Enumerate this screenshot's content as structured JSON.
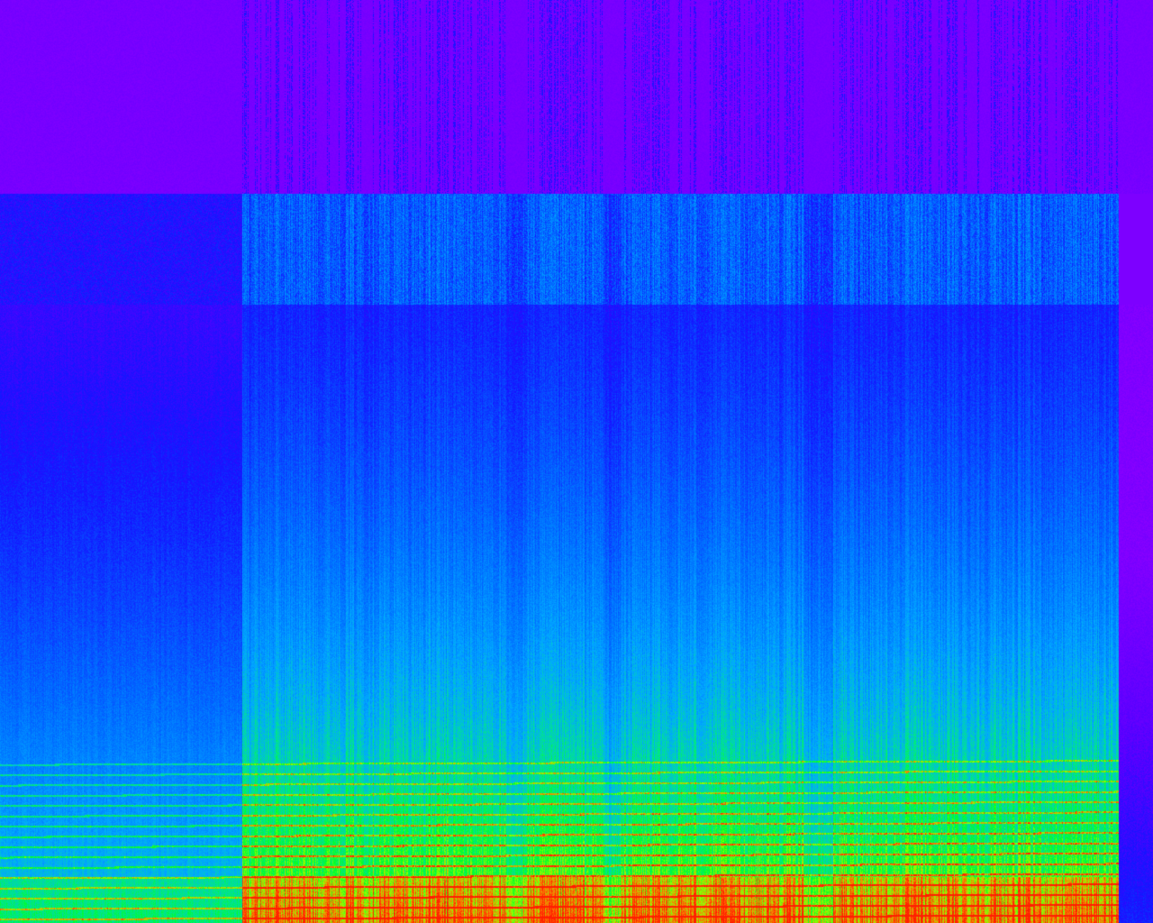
{
  "image": {
    "kind": "spectrogram",
    "description_visible_text": "",
    "colormap": [
      "#8a00ff",
      "#1010ff",
      "#00a8ff",
      "#00ff40",
      "#9aff00",
      "#ff3000"
    ],
    "background_color": "#8a00ff",
    "regions": {
      "intro_quiet_section": {
        "x_fraction_start": 0.0,
        "x_fraction_end": 0.21
      },
      "main_section": {
        "x_fraction_start": 0.21,
        "x_fraction_end": 0.97
      },
      "tail_silence": {
        "x_fraction_start": 0.97,
        "x_fraction_end": 1.0
      }
    },
    "high_cut_bands": {
      "upper_band_fraction": 0.21,
      "lower_band_fraction": 0.33
    }
  }
}
